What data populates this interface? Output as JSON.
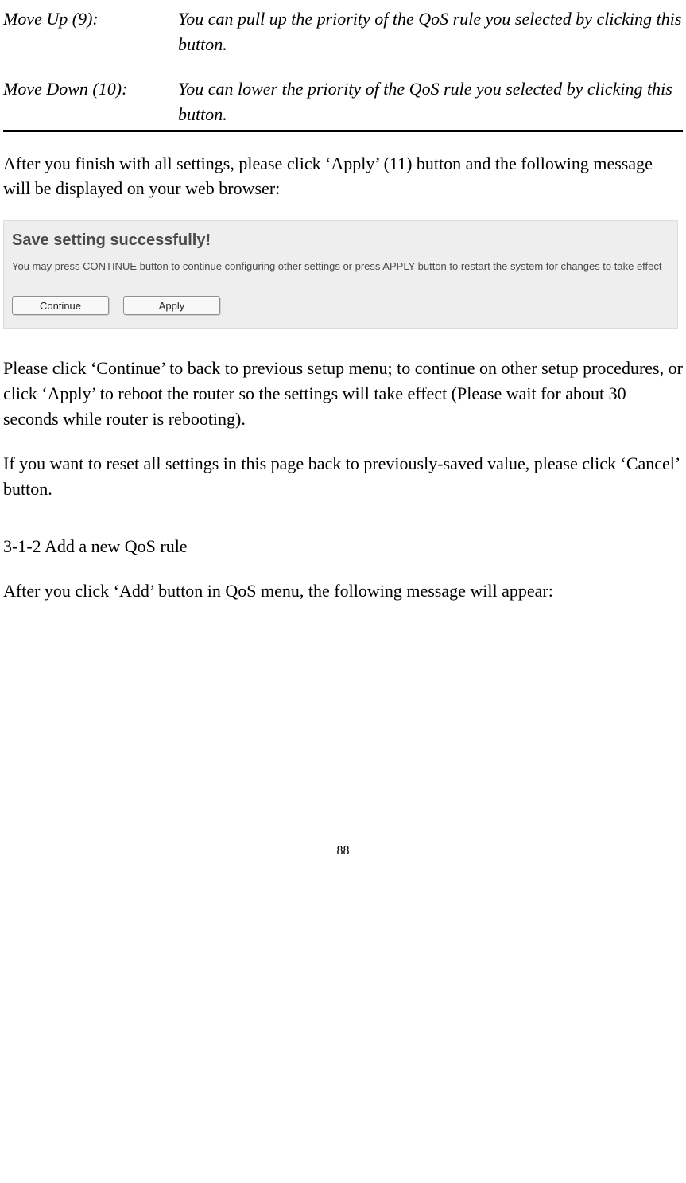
{
  "definitions": [
    {
      "label": "Move Up (9):",
      "desc": "You can pull up the priority of the QoS rule you selected by clicking this button."
    },
    {
      "label": "Move Down (10):",
      "desc": "You can lower the priority of the QoS rule you selected by clicking this button."
    }
  ],
  "para_after_defs": "After you finish with all settings, please click ‘Apply’ (11) button and the following message will be displayed on your web browser:",
  "dialog": {
    "title": "Save setting successfully!",
    "message": "You may press CONTINUE button to continue configuring other settings or press APPLY button to restart the system for changes to take effect",
    "continue_label": "Continue",
    "apply_label": "Apply"
  },
  "para_after_dialog_1": "Please click ‘Continue’ to back to previous setup menu; to continue on other setup procedures, or click ‘Apply’ to reboot the router so the settings will take effect (Please wait for about 30 seconds while router is rebooting).",
  "para_after_dialog_2": "If you want to reset all settings in this page back to previously-saved value, please click ‘Cancel’ button.",
  "section_heading": "3-1-2 Add a new QoS rule",
  "para_section": "After you click ‘Add’ button in QoS menu, the following message will appear:",
  "page_number": "88"
}
